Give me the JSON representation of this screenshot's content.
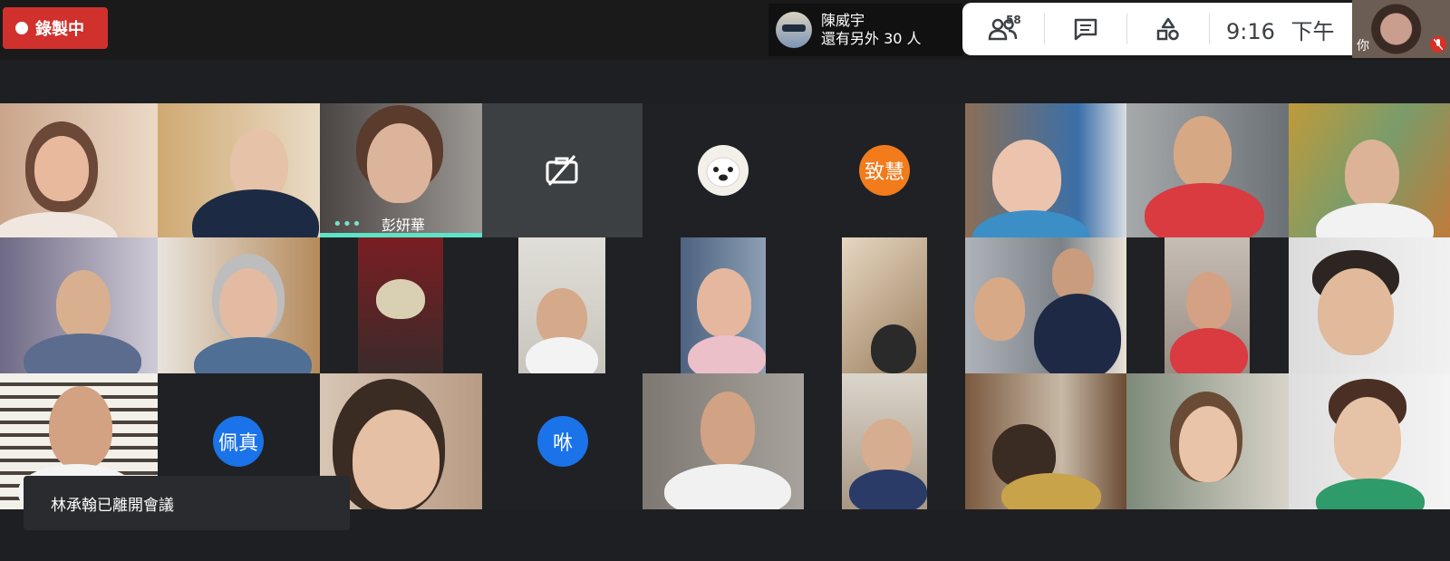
{
  "recording": {
    "label": "錄製中"
  },
  "presenter": {
    "name": "陳威宇",
    "more_text": "還有另外 30 人"
  },
  "controls": {
    "participants_count": "58",
    "time": "9:16",
    "ampm": "下午"
  },
  "self_view": {
    "label": "你"
  },
  "speaker": {
    "name": "彭妍華"
  },
  "avatars": {
    "zhihui": "致慧",
    "peizhen": "佩真",
    "lai": "咻"
  },
  "notification": {
    "text": "林承翰已離開會議"
  },
  "colors": {
    "recording": "#d0312d",
    "speaking_indicator": "#5ce3c8",
    "avatar_orange": "#f27b1c",
    "avatar_blue": "#1a73e8"
  }
}
